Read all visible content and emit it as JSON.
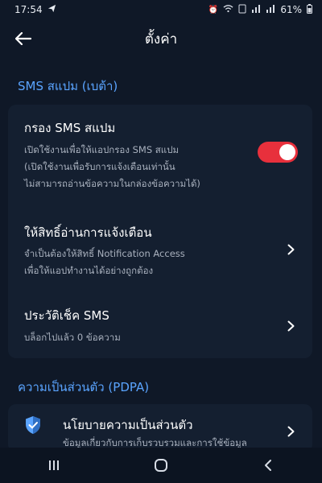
{
  "status_bar": {
    "time": "17:54",
    "battery": "61%"
  },
  "app_bar": {
    "title": "ตั้งค่า"
  },
  "sections": [
    {
      "title": "SMS สแปม (เบต้า)",
      "items": [
        {
          "title": "กรอง SMS สแปม",
          "subtitle_lines": [
            "เปิดใช้งานเพื่อให้แอปกรอง SMS สแปม",
            "(เปิดใช้งานเพื่อรับการแจ้งเตือนเท่านั้น",
            "ไม่สามารถอ่านข้อความในกล่องข้อความได้)"
          ],
          "toggle_on": true
        },
        {
          "title": "ให้สิทธิ์อ่านการแจ้งเตือน",
          "subtitle_lines": [
            "จำเป็นต้องให้สิทธิ์ Notification Access",
            "เพื่อให้แอปทำงานได้อย่างถูกต้อง"
          ]
        },
        {
          "title": "ประวัติเช็ค SMS",
          "subtitle_lines": [
            "บล็อกไปแล้ว 0 ข้อความ"
          ]
        }
      ]
    },
    {
      "title": "ความเป็นส่วนตัว (PDPA)",
      "items": [
        {
          "title": "นโยบายความเป็นส่วนตัว",
          "subtitle_lines": [
            "ข้อมูลเกี่ยวกับการเก็บรวบรวมและการใช้ข้อมูล"
          ]
        }
      ]
    }
  ],
  "colors": {
    "accent": "#5aa4ff",
    "toggle_on": "#e8303c",
    "background": "#0f1827",
    "card": "#141f30"
  }
}
